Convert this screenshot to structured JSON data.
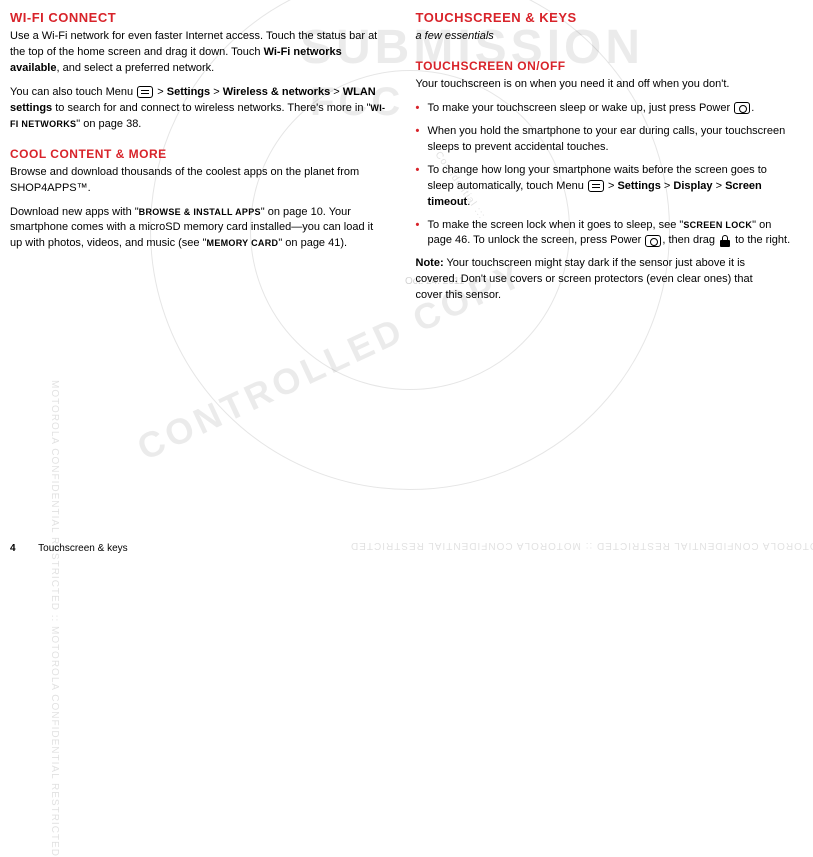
{
  "left": {
    "h1": "WI-FI CONNECT",
    "p1a": "Use a Wi-Fi network for even faster Internet access. Touch the status bar at the top of the home screen and drag it down. Touch ",
    "p1b": "Wi-Fi networks available",
    "p1c": ", and select a preferred network.",
    "p2a": "You can also touch Menu ",
    "p2b": " > ",
    "p2c": "Settings",
    "p2d": " > ",
    "p2e": "Wireless & networks",
    "p2f": " > ",
    "p2g": "WLAN settings",
    "p2h": " to search for and connect to wireless networks. There's more in \"",
    "p2i": "WI-FI NETWORKS",
    "p2j": "\" on page 38.",
    "h2a": "COOL CONTENT & MORE",
    "p3": "Browse and download thousands of the coolest apps on the planet from SHOP4APPS™.",
    "p4a": "Download new apps with \"",
    "p4b": "BROWSE & INSTALL APPS",
    "p4c": "\" on page 10. Your smartphone comes with a microSD memory card installed—you can load it up with photos, videos, and music (see \"",
    "p4d": "MEMORY CARD",
    "p4e": "\" on page 41)."
  },
  "right": {
    "h1": "TOUCHSCREEN & KEYS",
    "sub": "a few essentials",
    "h2": "TOUCHSCREEN ON/OFF",
    "p1": "Your touchscreen is on when you need it and off when you don't.",
    "li1a": "To make your touchscreen sleep or wake up, just press Power ",
    "li1b": ".",
    "li2": "When you hold the smartphone to your ear during calls, your touchscreen sleeps to prevent accidental touches.",
    "li3a": "To change how long your smartphone waits before the screen goes to sleep automatically, touch Menu ",
    "li3b": " > ",
    "li3c": "Settings",
    "li3d": " > ",
    "li3e": "Display",
    "li3f": " > ",
    "li3g": "Screen timeout",
    "li3h": ".",
    "li4a": "To make the screen lock when it goes to sleep, see \"",
    "li4b": "SCREEN LOCK",
    "li4c": "\" on page 46. To unlock the screen, press Power ",
    "li4d": ", then drag ",
    "li4e": " to the right.",
    "noteLabel": "Note:",
    "noteBody": " Your touchscreen might stay dark if the sensor just above it is covered. Don't use covers or screen protectors (even clear ones) that cover this sensor."
  },
  "footer": {
    "page": "4",
    "section": "Touchscreen & keys"
  },
  "watermark": {
    "confidential": "MOTOROLA CONFIDENTIAL RESTRICTED :: MOTOROLA CONFIDENTIAL RESTRICTED",
    "submission": "SUBMISSION",
    "controlled": "CONTROLLED COPY",
    "fcc": "FCC",
    "conf2": "Confidential :::",
    "date": "Oct. 24. 2011"
  }
}
